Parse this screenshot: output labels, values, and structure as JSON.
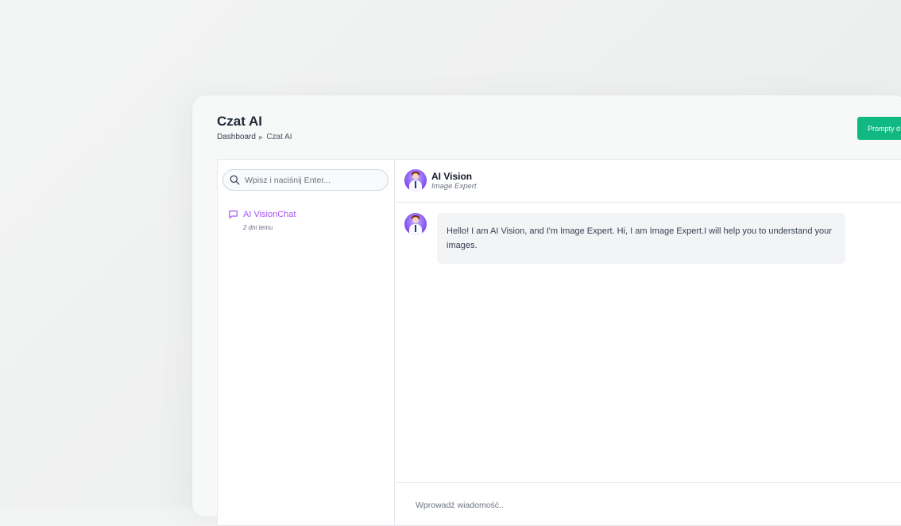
{
  "page": {
    "title": "Czat AI",
    "breadcrumb": [
      "Dashboard",
      "Czat AI"
    ],
    "action_button": "Prompty d"
  },
  "sidebar": {
    "search_placeholder": "Wpisz i naciśnij Enter...",
    "chats": [
      {
        "name": "AI VisionChat",
        "time": "2 dni temu"
      }
    ]
  },
  "chat": {
    "assistant_name": "AI Vision",
    "assistant_role": "Image Expert",
    "messages": [
      {
        "text": "Hello! I am AI Vision, and I'm Image Expert. Hi, I am Image Expert.I will help you to understand your images."
      }
    ],
    "input_placeholder": "Wprowadź wiadomość.."
  },
  "colors": {
    "accent": "#10b981",
    "chat_item": "#a855f7"
  },
  "icons": {
    "search": "search-icon",
    "chat": "chat-bubble-icon",
    "breadcrumb_separator": "chevron-right-icon"
  }
}
